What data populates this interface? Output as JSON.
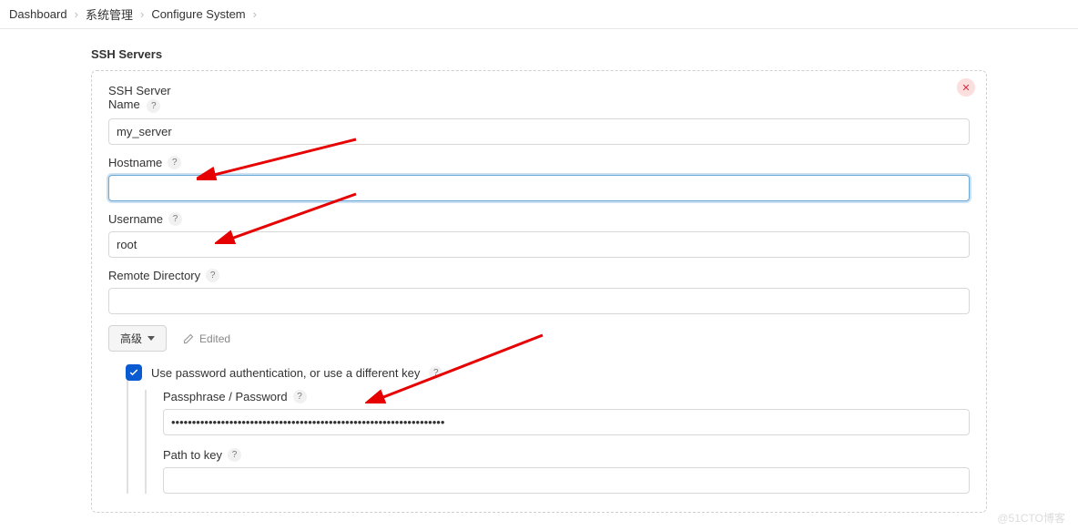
{
  "breadcrumb": {
    "items": [
      "Dashboard",
      "系统管理",
      "Configure System"
    ]
  },
  "section_title": "SSH Servers",
  "close_icon": "✕",
  "fields": {
    "name": {
      "label1": "SSH Server",
      "label2": "Name",
      "value": "my_server"
    },
    "hostname": {
      "label": "Hostname",
      "value": ""
    },
    "username": {
      "label": "Username",
      "value": "root"
    },
    "remote_dir": {
      "label": "Remote Directory",
      "value": ""
    }
  },
  "advanced_label": "高级",
  "edited_label": "Edited",
  "use_password": {
    "checked": true,
    "label": "Use password authentication, or use a different key"
  },
  "passphrase": {
    "label": "Passphrase / Password",
    "value": "••••••••••••••••••••••••••••••••••••••••••••••••••••••••••••••••••"
  },
  "path_to_key": {
    "label": "Path to key",
    "value": ""
  },
  "watermark": "@51CTO博客"
}
